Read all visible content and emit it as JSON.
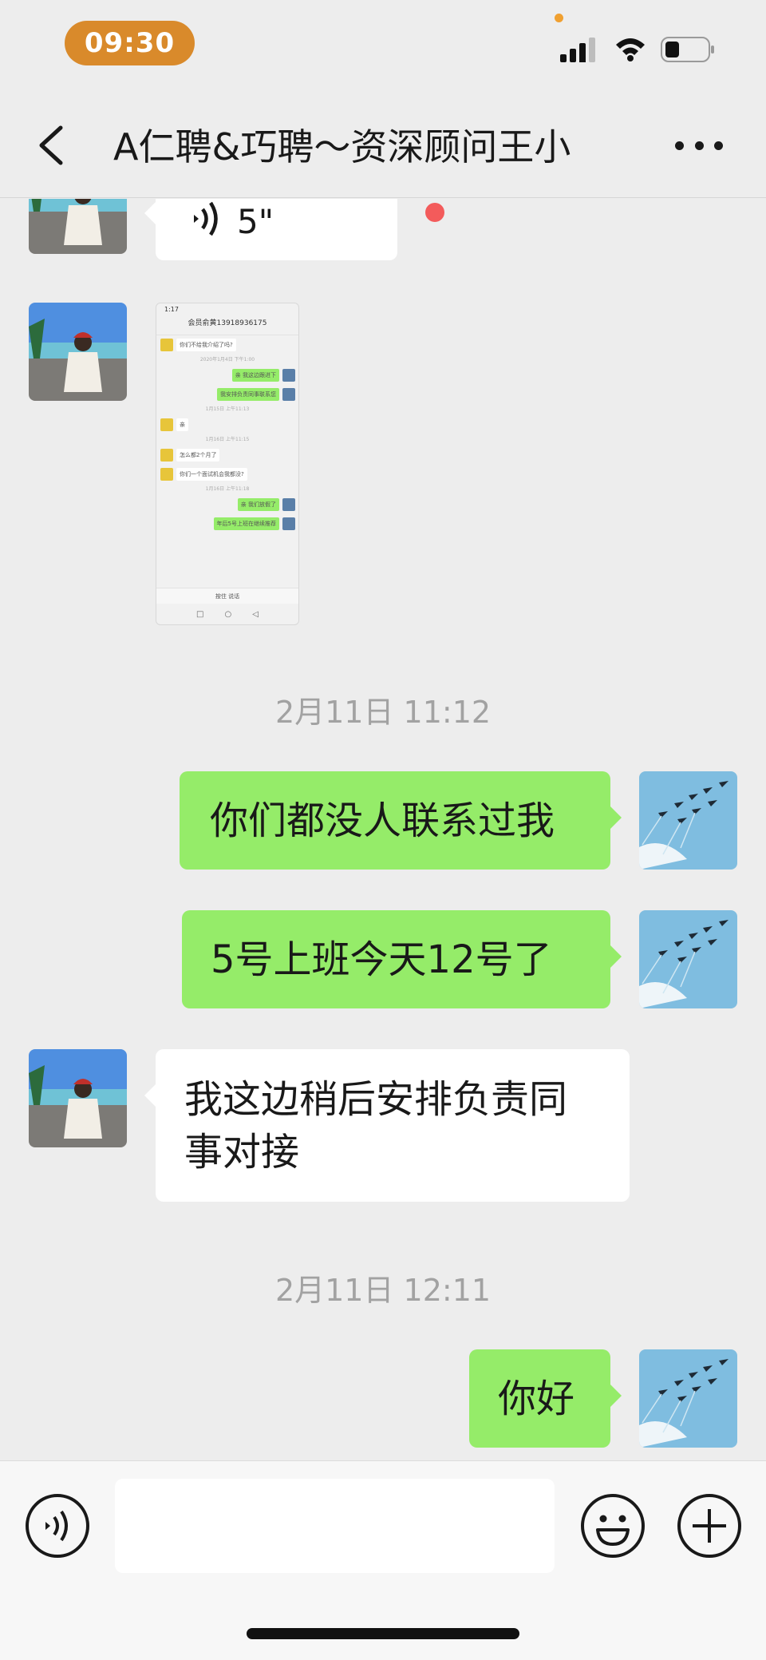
{
  "status_bar": {
    "time": "09:30"
  },
  "header": {
    "title": "A仁聘&巧聘～资深顾问王小"
  },
  "messages": {
    "voice": {
      "duration": "5\""
    },
    "screenshot": {
      "status_time": "1:17",
      "title": "会员俞黄13918936175",
      "lines": [
        "你们不给我介绍了吗?",
        "2020年1月4日 下午1:00",
        "亲 我这边跟进下",
        "我安排负责同事联系您",
        "1月15日 上午11:13",
        "亲",
        "1月16日 上午11:15",
        "怎么都2个月了",
        "你们一个面试机会我都没?",
        "1月16日 上午11:18",
        "亲 我们放假了",
        "年后5号上班在继续推荐"
      ],
      "input_hint": "按住 说话"
    },
    "ts1": "2月11日 11:12",
    "sent1": "你们都没人联系过我",
    "sent2": "5号上班今天12号了",
    "received1": "我这边稍后安排负责同事对接",
    "ts2": "2月11日 12:11",
    "sent3": "你好"
  },
  "input_bar": {
    "value": ""
  },
  "icons": {
    "back": "chevron-left-icon",
    "more": "more-dots-icon",
    "voice": "voice-icon",
    "emoji": "emoji-icon",
    "plus": "plus-icon"
  },
  "colors": {
    "sent_bubble": "#95ec69",
    "received_bubble": "#ffffff",
    "background": "#ededed",
    "time_pill": "#d98a2b",
    "unread_dot": "#f35b5b"
  }
}
